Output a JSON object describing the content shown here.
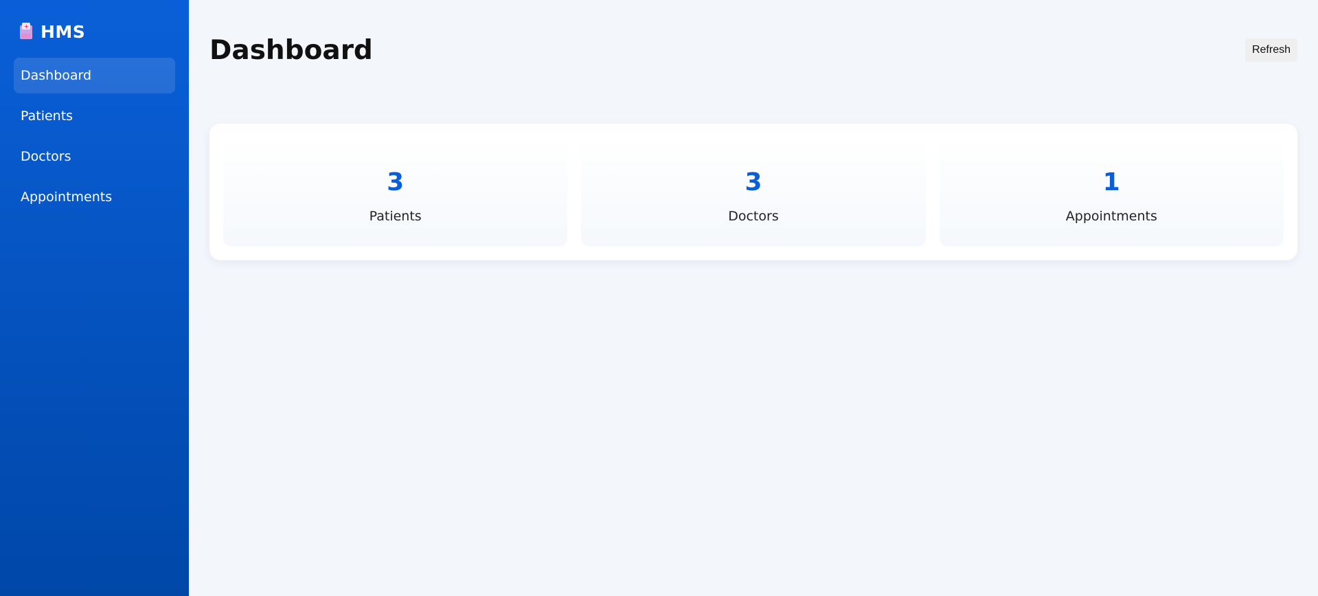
{
  "sidebar": {
    "brand": {
      "icon": "hospital-icon",
      "title": "HMS"
    },
    "items": [
      {
        "label": "Dashboard",
        "active": true
      },
      {
        "label": "Patients",
        "active": false
      },
      {
        "label": "Doctors",
        "active": false
      },
      {
        "label": "Appointments",
        "active": false
      }
    ]
  },
  "header": {
    "title": "Dashboard",
    "refresh_label": "Refresh"
  },
  "stats": [
    {
      "value": "3",
      "label": "Patients"
    },
    {
      "value": "3",
      "label": "Doctors"
    },
    {
      "value": "1",
      "label": "Appointments"
    }
  ],
  "colors": {
    "accent": "#0a5fd8",
    "sidebar_top": "#0a5fd8",
    "sidebar_bottom": "#0047a8",
    "background": "#f3f6fb"
  }
}
